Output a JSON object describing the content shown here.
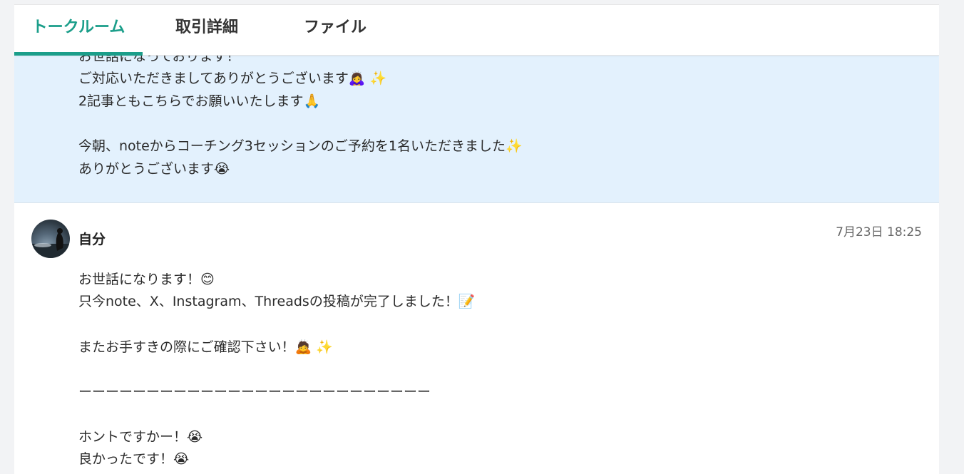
{
  "tabs": [
    {
      "label": "トークルーム",
      "active": true
    },
    {
      "label": "取引詳細",
      "active": false
    },
    {
      "label": "ファイル",
      "active": false
    }
  ],
  "colors": {
    "accent": "#1b9e8a",
    "highlight_bg": "#e3f1fd"
  },
  "previous_message": {
    "lines": [
      "お世話になっております！",
      "ご対応いただきましてありがとうございます🙇‍♀️ ✨",
      "2記事ともこちらでお願いいたします🙏",
      "今朝、noteからコーチング3セッションのご予約を1名いただきました✨",
      "ありがとうございます😭"
    ]
  },
  "current_message": {
    "sender": "自分",
    "timestamp": "7月23日 18:25",
    "lines": [
      "お世話になります！😊",
      "只今note、X、Instagram、Threadsの投稿が完了しました！📝",
      "またお手すきの際にご確認下さい！🙇 ✨",
      "ーーーーーーーーーーーーーーーーーーーーーーーーーー",
      "ホントですかー！😭",
      "良かったです！😭"
    ]
  }
}
